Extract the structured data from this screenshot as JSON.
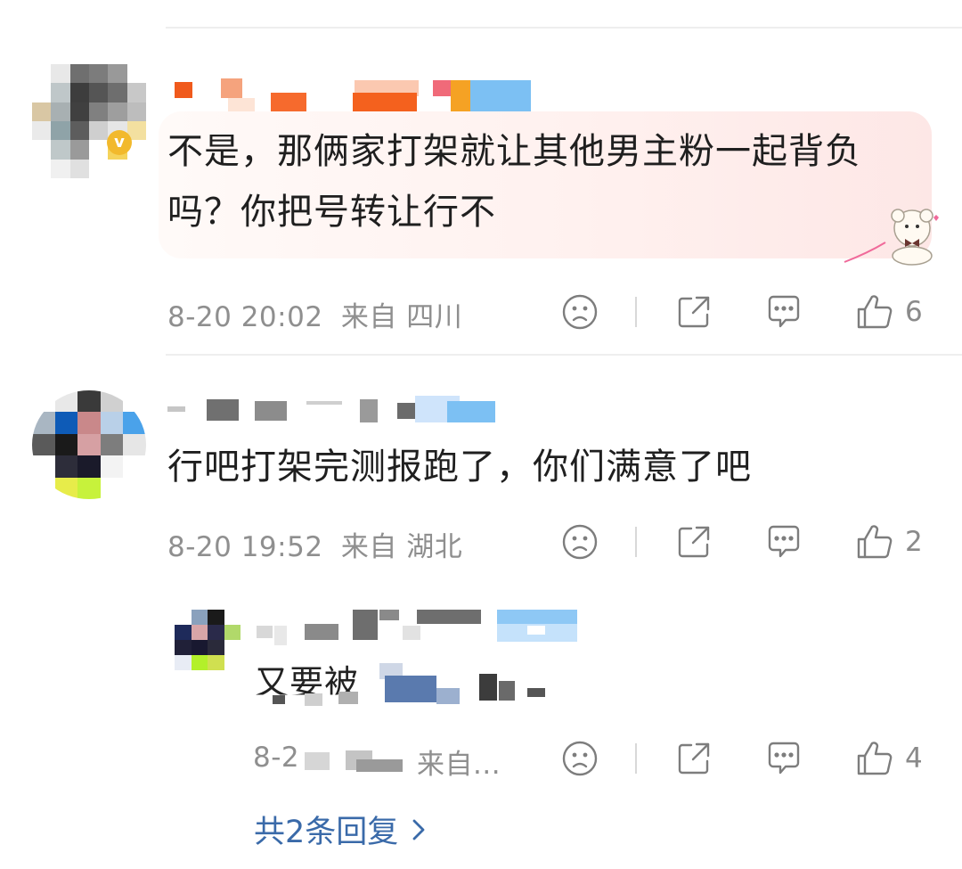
{
  "comments": [
    {
      "text": "不是，那俩家打架就让其他男主粉一起背负吗？你把号转让行不",
      "time": "8-20 20:02",
      "location": "来自 四川",
      "likes": "6"
    },
    {
      "text": "行吧打架完测报跑了，你们满意了吧",
      "time": "8-20 19:52",
      "location": "来自 湖北",
      "likes": "2"
    }
  ],
  "reply": {
    "text_partial": "又要被",
    "time_partial": "8-2",
    "location_partial": "来自...",
    "likes": "4"
  },
  "more_replies": {
    "label": "共2条回复"
  },
  "icons": {
    "dislike": "sad-face-icon",
    "share": "share-icon",
    "comment": "comment-bubble-icon",
    "like": "thumbs-up-icon",
    "chevron": "chevron-right-icon"
  },
  "colors": {
    "link": "#3a6aa9",
    "meta_text": "#8f8f8f",
    "bubble_accent": "#fde7e6"
  }
}
